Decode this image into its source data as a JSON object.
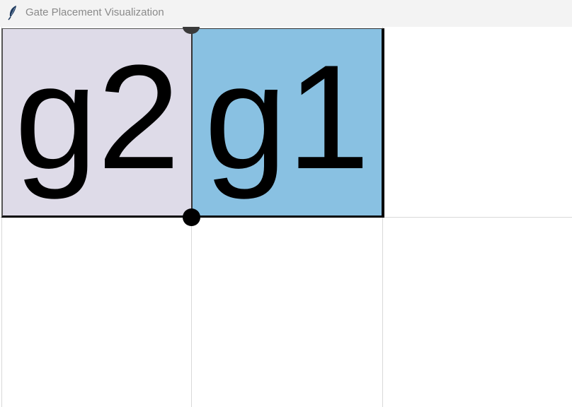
{
  "window": {
    "title": "Gate Placement Visualization",
    "icon": "feather-icon"
  },
  "grid": {
    "columns": 3,
    "rows": 2,
    "line_color": "#d9d9d9"
  },
  "gates": [
    {
      "label": "g2",
      "column": 0,
      "row": 0,
      "fill": "#dedbe8"
    },
    {
      "label": "g1",
      "column": 1,
      "row": 0,
      "fill": "#89c1e2"
    }
  ],
  "colors": {
    "titlebar_bg": "#f3f3f3",
    "title_text": "#8a8a8a",
    "outline": "#000000",
    "node": "#000000"
  }
}
